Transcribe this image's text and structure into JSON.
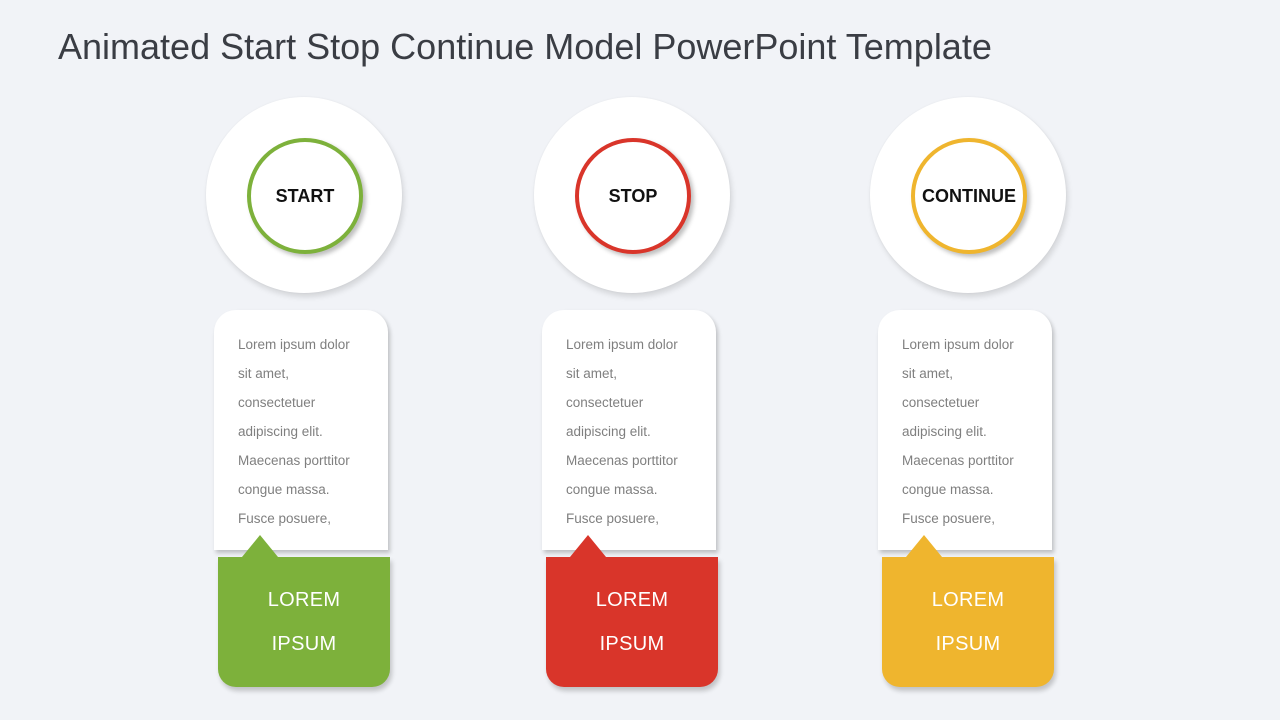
{
  "slide": {
    "title": "Animated Start Stop Continue Model PowerPoint Template",
    "background_color": "#f1f3f7"
  },
  "columns": [
    {
      "label": "START",
      "color": "#7db13b",
      "body_lines": [
        "Lorem ipsum dolor",
        "sit amet,",
        "consectetuer",
        "adipiscing elit.",
        "Maecenas porttitor",
        "congue massa.",
        "Fusce posuere,"
      ],
      "footer_lines": [
        "LOREM",
        "IPSUM"
      ]
    },
    {
      "label": "STOP",
      "color": "#d9352a",
      "body_lines": [
        "Lorem ipsum dolor",
        "sit amet,",
        "consectetuer",
        "adipiscing elit.",
        "Maecenas porttitor",
        "congue massa.",
        "Fusce posuere,"
      ],
      "footer_lines": [
        "LOREM",
        "IPSUM"
      ]
    },
    {
      "label": "CONTINUE",
      "color": "#efb52e",
      "body_lines": [
        "Lorem ipsum dolor",
        "sit amet,",
        "consectetuer",
        "adipiscing elit.",
        "Maecenas porttitor",
        "congue massa.",
        "Fusce posuere,"
      ],
      "footer_lines": [
        "LOREM",
        "IPSUM"
      ]
    }
  ]
}
